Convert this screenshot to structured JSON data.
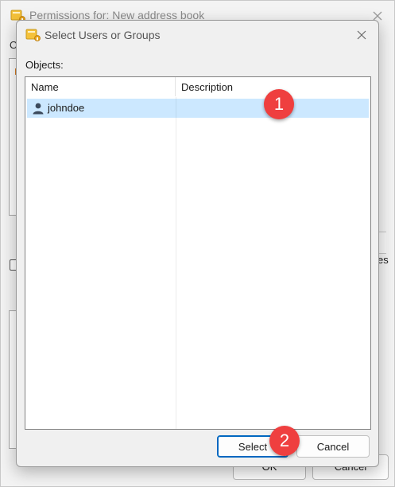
{
  "parent_window": {
    "title": "Permissions for: New address book",
    "fragment_o": "O",
    "fragment_es": "es",
    "ok_label": "OK",
    "cancel_label": "Cancel"
  },
  "dialog": {
    "title": "Select Users or Groups",
    "objects_label": "Objects:",
    "columns": {
      "name": "Name",
      "description": "Description"
    },
    "rows": [
      {
        "name": "johndoe",
        "description": "",
        "icon": "user-icon",
        "selected": true
      }
    ],
    "select_label": "Select",
    "cancel_label": "Cancel"
  },
  "annotations": {
    "badge_1": "1",
    "badge_2": "2",
    "color": "#ef3f3f"
  },
  "colors": {
    "selection": "#cce8ff",
    "default_button_border": "#0067c0"
  }
}
